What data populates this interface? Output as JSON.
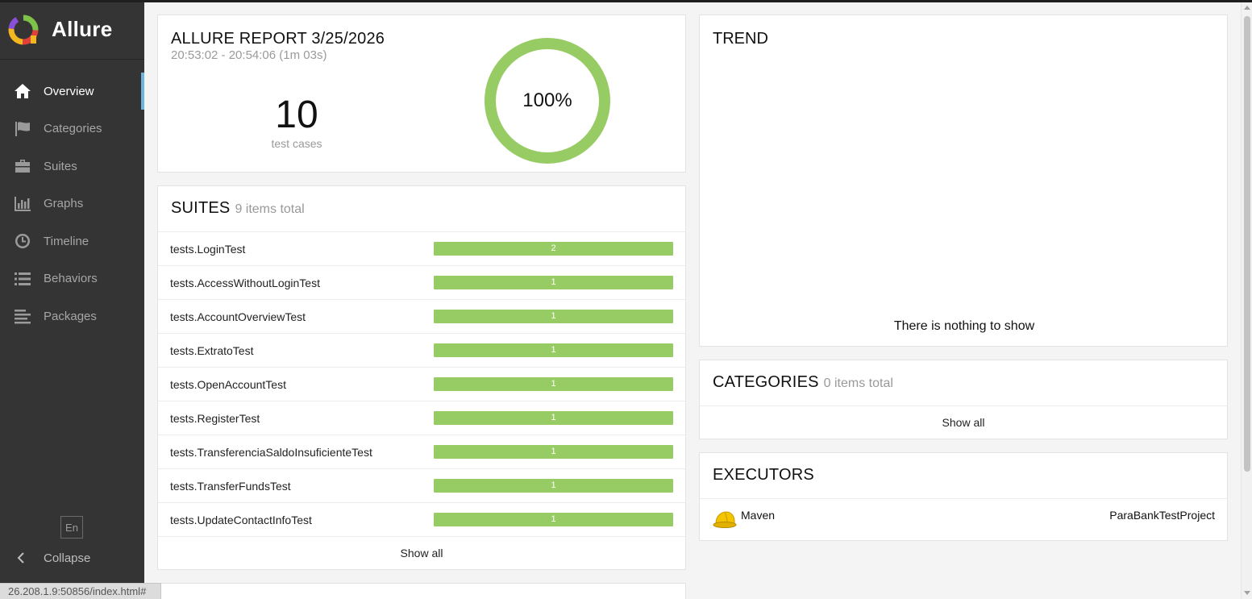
{
  "app": {
    "name": "Allure"
  },
  "sidebar": {
    "items": [
      {
        "label": "Overview",
        "icon": "home-icon",
        "active": true
      },
      {
        "label": "Categories",
        "icon": "flag-icon"
      },
      {
        "label": "Suites",
        "icon": "briefcase-icon"
      },
      {
        "label": "Graphs",
        "icon": "bar-chart-icon"
      },
      {
        "label": "Timeline",
        "icon": "clock-icon"
      },
      {
        "label": "Behaviors",
        "icon": "list-icon"
      },
      {
        "label": "Packages",
        "icon": "align-left-icon"
      }
    ],
    "language": "En",
    "collapse_label": "Collapse"
  },
  "statusbar": {
    "url": "26.208.1.9:50856/index.html#"
  },
  "summary": {
    "title": "ALLURE REPORT 3/25/2026",
    "time_range": "20:53:02 - 20:54:06 (1m 03s)",
    "count": "10",
    "count_label": "test cases",
    "pass_rate": "100%",
    "pass_fraction": 1.0,
    "color": "#97cc64"
  },
  "suites": {
    "title": "SUITES",
    "subtitle": "9 items total",
    "rows": [
      {
        "name": "tests.LoginTest",
        "count": "2"
      },
      {
        "name": "tests.AccessWithoutLoginTest",
        "count": "1"
      },
      {
        "name": "tests.AccountOverviewTest",
        "count": "1"
      },
      {
        "name": "tests.ExtratoTest",
        "count": "1"
      },
      {
        "name": "tests.OpenAccountTest",
        "count": "1"
      },
      {
        "name": "tests.RegisterTest",
        "count": "1"
      },
      {
        "name": "tests.TransferenciaSaldoInsuficienteTest",
        "count": "1"
      },
      {
        "name": "tests.TransferFundsTest",
        "count": "1"
      },
      {
        "name": "tests.UpdateContactInfoTest",
        "count": "1"
      }
    ],
    "show_all": "Show all"
  },
  "trend": {
    "title": "TREND",
    "empty": "There is nothing to show"
  },
  "categories": {
    "title": "CATEGORIES",
    "subtitle": "0 items total",
    "show_all": "Show all"
  },
  "executors": {
    "title": "EXECUTORS",
    "name": "Maven",
    "build": "ParaBankTestProject",
    "icon": "helmet-icon"
  }
}
